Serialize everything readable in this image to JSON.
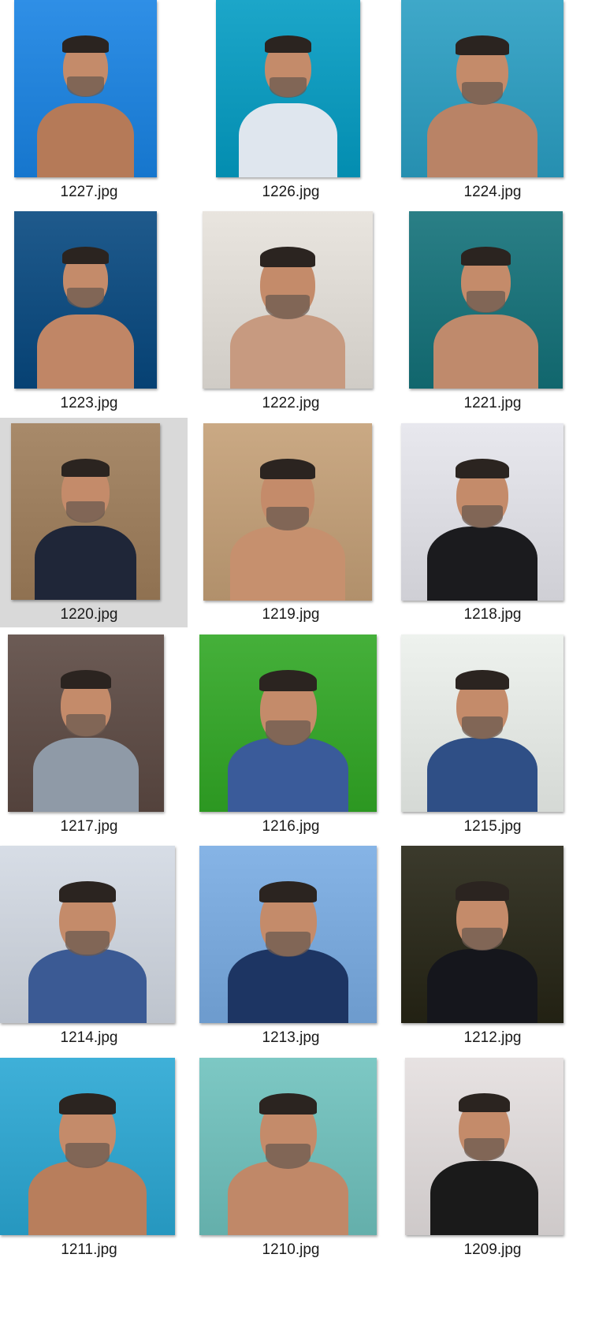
{
  "selected_file": "1220.jpg",
  "files": [
    {
      "name": "1227.jpg",
      "scene": "pool-underwater-selfie",
      "bg": "#2f8fe6",
      "body": "#b57a58"
    },
    {
      "name": "1226.jpg",
      "scene": "sea-shirt",
      "bg": "#1ca6c9",
      "body": "#dfe6ee"
    },
    {
      "name": "1224.jpg",
      "scene": "pool-edge",
      "bg": "#3fa8c9",
      "body": "#b98366"
    },
    {
      "name": "1223.jpg",
      "scene": "sea-swimsuit",
      "bg": "#1f5a8c",
      "body": "#c08666"
    },
    {
      "name": "1222.jpg",
      "scene": "bed-glasses-selfie",
      "bg": "#e9e5df",
      "body": "#c79a80"
    },
    {
      "name": "1221.jpg",
      "scene": "pool-tiles-selfie",
      "bg": "#2a7f86",
      "body": "#bf8a6c"
    },
    {
      "name": "1220.jpg",
      "scene": "train-suit-selfie",
      "bg": "#a88a6a",
      "body": "#1f2638"
    },
    {
      "name": "1219.jpg",
      "scene": "bed-selfie",
      "bg": "#caa984",
      "body": "#c6906e"
    },
    {
      "name": "1218.jpg",
      "scene": "event-suit",
      "bg": "#e8e8ee",
      "body": "#1b1b1e"
    },
    {
      "name": "1217.jpg",
      "scene": "glasses-sweater-selfie",
      "bg": "#6c5b55",
      "body": "#8f9aa7"
    },
    {
      "name": "1216.jpg",
      "scene": "green-room-meeting",
      "bg": "#45b03a",
      "body": "#3a5b9a"
    },
    {
      "name": "1215.jpg",
      "scene": "group-photo",
      "bg": "#eef2ee",
      "body": "#2f4f86"
    },
    {
      "name": "1214.jpg",
      "scene": "panel-talk",
      "bg": "#d7dde6",
      "body": "#3b5a94"
    },
    {
      "name": "1213.jpg",
      "scene": "garden-blazer",
      "bg": "#86b4e6",
      "body": "#1d3563"
    },
    {
      "name": "1212.jpg",
      "scene": "evening-suit",
      "bg": "#3b3a2c",
      "body": "#15161c"
    },
    {
      "name": "1211.jpg",
      "scene": "pool-wet-hair",
      "bg": "#3fb0d8",
      "body": "#b87e5c"
    },
    {
      "name": "1210.jpg",
      "scene": "beach-water",
      "bg": "#7dc8c4",
      "body": "#c08868"
    },
    {
      "name": "1209.jpg",
      "scene": "photocall-tshirt",
      "bg": "#e7e2e2",
      "body": "#1a1a1a"
    }
  ]
}
